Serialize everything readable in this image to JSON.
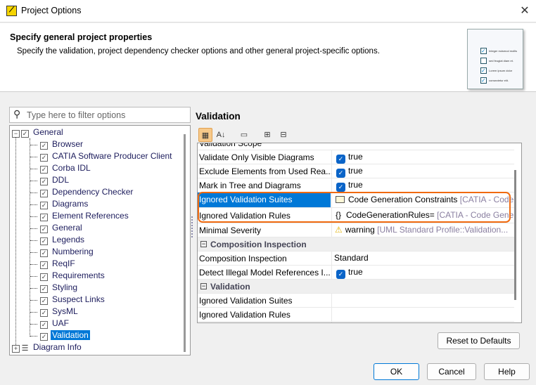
{
  "window": {
    "title": "Project Options",
    "close": "✕"
  },
  "header": {
    "title": "Specify general project properties",
    "subtitle": "Specify the validation, project dependency checker options and other general project-specific options.",
    "doc_lines": [
      "Integer euismod mollis",
      "sed feugiat diam et.",
      "Lorem ipsum dolor",
      "consectetur elit."
    ]
  },
  "filter": {
    "placeholder": "Type here to filter options",
    "icon": "search-icon"
  },
  "tree": {
    "root": "General",
    "children": [
      "Browser",
      "CATIA Software Producer Client",
      "Corba IDL",
      "DDL",
      "Dependency Checker",
      "Diagrams",
      "Element References",
      "General",
      "Legends",
      "Numbering",
      "ReqIF",
      "Requirements",
      "Styling",
      "Suspect Links",
      "SysML",
      "UAF",
      "Validation"
    ],
    "selected": "Validation",
    "next": "Diagram Info"
  },
  "panel": {
    "title": "Validation"
  },
  "grid": {
    "partial": "Validation Scope",
    "rows": [
      {
        "key": "Validate Only Visible Diagrams",
        "value": "true"
      },
      {
        "key": "Exclude Elements from Used Rea...",
        "value": "true"
      },
      {
        "key": "Mark in Tree and Diagrams",
        "value": "true"
      },
      {
        "key": "Ignored Validation Suites",
        "value": "Code Generation Constraints",
        "extra": "[CATIA - Code"
      },
      {
        "key": "Ignored Validation Rules",
        "value": "CodeGenerationRules=",
        "extra": "[CATIA - Code Gene"
      },
      {
        "key": "Minimal Severity",
        "value": "warning",
        "extra": "[UML Standard Profile::Validation..."
      }
    ],
    "cat1": "Composition Inspection",
    "rows2": [
      {
        "key": "Composition Inspection",
        "value": "Standard"
      },
      {
        "key": "Detect Illegal Model References I...",
        "value": "true"
      }
    ],
    "cat2": "Validation",
    "rows3": [
      {
        "key": "Ignored Validation Suites"
      },
      {
        "key": "Ignored Validation Rules"
      }
    ]
  },
  "buttons": {
    "reset": "Reset to Defaults",
    "ok": "OK",
    "cancel": "Cancel",
    "help": "Help"
  },
  "colors": {
    "accent": "#0078d7",
    "highlight": "#f06a10"
  }
}
